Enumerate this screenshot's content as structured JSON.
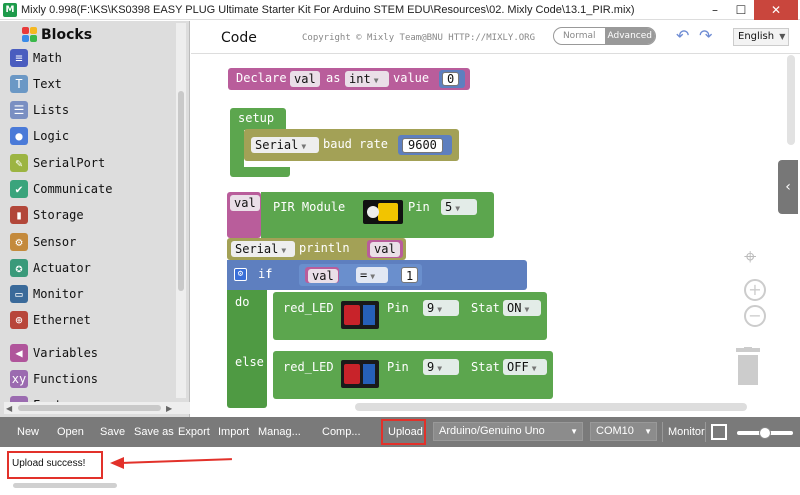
{
  "window": {
    "title": "Mixly 0.998(F:\\KS\\KS0398 EASY PLUG Ultimate Starter Kit For Arduino STEM EDU\\Resources\\02. Mixly Code\\13.1_PIR.mix)",
    "minimize": "–",
    "maximize": "☐",
    "close": "✕"
  },
  "sidebar": {
    "header": "Blocks",
    "categories": [
      {
        "label": "Math",
        "icon": "math-icon",
        "color": "#4a5dbf",
        "glyph": "≡"
      },
      {
        "label": "Text",
        "icon": "text-icon",
        "color": "#6b98c5",
        "glyph": "T"
      },
      {
        "label": "Lists",
        "icon": "lists-icon",
        "color": "#7a8fc2",
        "glyph": "☰"
      },
      {
        "label": "Logic",
        "icon": "logic-icon",
        "color": "#4a7ad8",
        "glyph": "●"
      },
      {
        "label": "SerialPort",
        "icon": "serialport-icon",
        "color": "#9cb442",
        "glyph": "✎"
      },
      {
        "label": "Communicate",
        "icon": "communicate-icon",
        "color": "#3aa47c",
        "glyph": "✔"
      },
      {
        "label": "Storage",
        "icon": "storage-icon",
        "color": "#b2473a",
        "glyph": "▮"
      },
      {
        "label": "Sensor",
        "icon": "sensor-icon",
        "color": "#c48a3c",
        "glyph": "⚙"
      },
      {
        "label": "Actuator",
        "icon": "actuator-icon",
        "color": "#3a9a7a",
        "glyph": "✪"
      },
      {
        "label": "Monitor",
        "icon": "monitor-icon",
        "color": "#3a6a9a",
        "glyph": "▭"
      },
      {
        "label": "Ethernet",
        "icon": "ethernet-icon",
        "color": "#b8463a",
        "glyph": "⊕"
      },
      {
        "label": "Variables",
        "icon": "variables-icon",
        "color": "#b0559b",
        "glyph": "◀"
      },
      {
        "label": "Functions",
        "icon": "functions-icon",
        "color": "#9b6bb0",
        "glyph": "xy"
      },
      {
        "label": "Factory",
        "icon": "factory-icon",
        "color": "#9b6bb0",
        "glyph": "⌂"
      }
    ]
  },
  "topbar": {
    "tab": "Code",
    "copyright": "Copyright © Mixly Team@BNU HTTP://MIXLY.ORG",
    "mode_normal": "Normal",
    "mode_advanced": "Advanced",
    "language": "English"
  },
  "blocks": {
    "declare": {
      "label": "Declare",
      "var": "val",
      "as": "as",
      "type": "int",
      "value_label": "value",
      "value": "0"
    },
    "setup": {
      "label": "setup",
      "serial": "Serial",
      "baud_label": "baud rate",
      "baud": "9600"
    },
    "pir": {
      "var": "val",
      "label": "PIR Module",
      "pin_label": "Pin",
      "pin": "5"
    },
    "println": {
      "serial": "Serial",
      "label": "println",
      "var": "val"
    },
    "if_block": {
      "if": "if",
      "var": "val",
      "op": "=",
      "value": "1",
      "do": "do",
      "else": "else"
    },
    "led_on": {
      "label": "red_LED",
      "pin_label": "Pin",
      "pin": "9",
      "stat_label": "Stat",
      "stat": "ON"
    },
    "led_off": {
      "label": "red_LED",
      "pin_label": "Pin",
      "pin": "9",
      "stat_label": "Stat",
      "stat": "OFF"
    }
  },
  "toolbar": {
    "new": "New",
    "open": "Open",
    "save": "Save",
    "save_as": "Save as",
    "export": "Export",
    "import": "Import",
    "manage": "Manag...",
    "compile": "Comp...",
    "upload": "Upload",
    "board": "Arduino/Genuino Uno",
    "port": "COM10",
    "monitor": "Monitor"
  },
  "console": {
    "message": "Upload success!"
  }
}
